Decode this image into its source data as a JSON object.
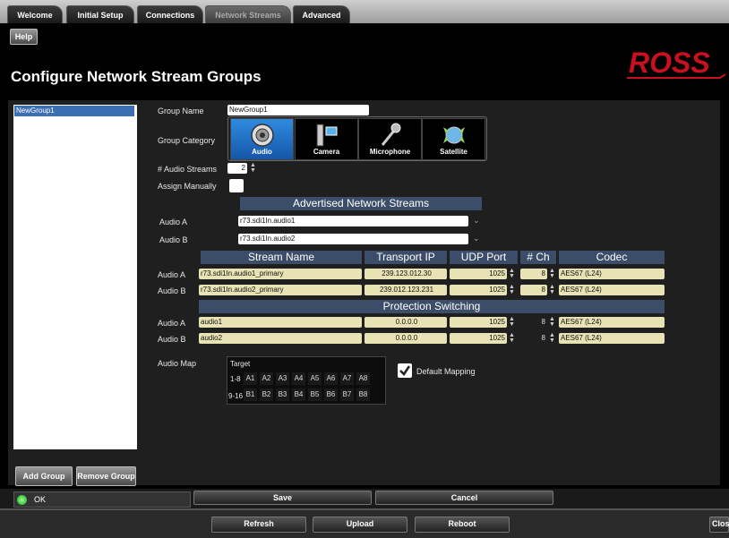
{
  "tabs": [
    {
      "label": "Welcome"
    },
    {
      "label": "Initial Setup"
    },
    {
      "label": "Connections"
    },
    {
      "label": "Network Streams"
    },
    {
      "label": "Advanced"
    }
  ],
  "help_label": "Help",
  "page_title": "Configure Network Stream Groups",
  "logo_text": "ROSS",
  "groups": [
    "NewGroup1"
  ],
  "group_name_label": "Group Name",
  "group_name_value": "NewGroup1",
  "group_category_label": "Group Category",
  "categories": [
    "Audio",
    "Camera",
    "Microphone",
    "Satellite"
  ],
  "num_streams_label": "# Audio Streams",
  "num_streams_value": "2",
  "assign_manually_label": "Assign Manually",
  "advertised_header": "Advertised Network Streams",
  "advertised": [
    {
      "label": "Audio A",
      "value": "r73.sdi1In.audio1"
    },
    {
      "label": "Audio B",
      "value": "r73.sdi1In.audio2"
    }
  ],
  "stream_headers": {
    "stream_name": "Stream Name",
    "transport_ip": "Transport IP",
    "udp_port": "UDP Port",
    "ch": "# Ch",
    "codec": "Codec"
  },
  "streams": [
    {
      "label": "Audio A",
      "name": "r73.sdi1In.audio1_primary",
      "ip": "239.123.012.30",
      "port": "1025",
      "ch": "8",
      "codec": "AES67 (L24)"
    },
    {
      "label": "Audio B",
      "name": "r73.sdi1In.audio2_primary",
      "ip": "239.012.123.231",
      "port": "1025",
      "ch": "8",
      "codec": "AES67 (L24)"
    }
  ],
  "protection_header": "Protection Switching",
  "protection": [
    {
      "label": "Audio A",
      "name": "audio1",
      "ip": "0.0.0.0",
      "port": "1025",
      "ch": "8",
      "codec": "AES67 (L24)"
    },
    {
      "label": "Audio B",
      "name": "audio2",
      "ip": "0.0.0.0",
      "port": "1025",
      "ch": "8",
      "codec": "AES67 (L24)"
    }
  ],
  "audio_map_label": "Audio Map",
  "audio_map": {
    "target_label": "Target",
    "row1_label": "1-8",
    "row1": [
      "A1",
      "A2",
      "A3",
      "A4",
      "A5",
      "A6",
      "A7",
      "A8"
    ],
    "row2_label": "9-16",
    "row2": [
      "B1",
      "B2",
      "B3",
      "B4",
      "B5",
      "B6",
      "B7",
      "B8"
    ]
  },
  "default_mapping_label": "Default Mapping",
  "add_group_label": "Add Group",
  "remove_group_label": "Remove Group",
  "status_text": "OK",
  "save_label": "Save",
  "cancel_label": "Cancel",
  "refresh_label": "Refresh",
  "upload_label": "Upload",
  "reboot_label": "Reboot",
  "close_label": "Clos",
  "colors": {
    "accent": "#2e8be0",
    "header": "#3b4d68",
    "field": "#e8e3b5",
    "logo": "#c8101e"
  }
}
